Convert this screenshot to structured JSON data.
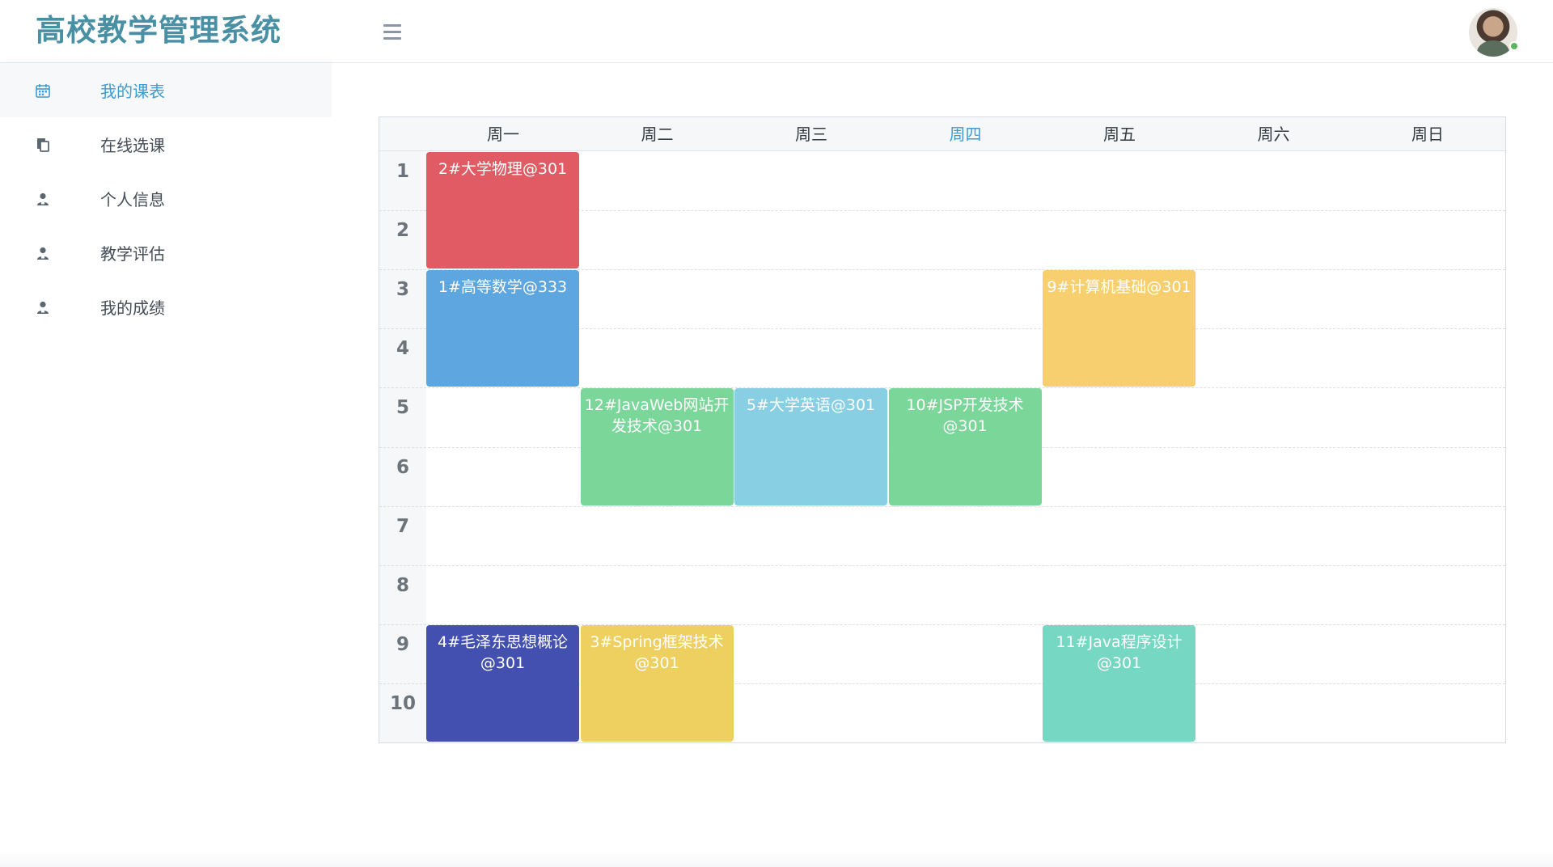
{
  "header": {
    "brand": "高校教学管理系统",
    "menu_icon": "hamburger-menu-icon",
    "avatar_status_color": "#5cb85c"
  },
  "sidebar": {
    "items": [
      {
        "label": "我的课表",
        "icon": "calendar-icon",
        "active": true
      },
      {
        "label": "在线选课",
        "icon": "copy-icon",
        "active": false
      },
      {
        "label": "个人信息",
        "icon": "user-icon",
        "active": false
      },
      {
        "label": "教学评估",
        "icon": "user-icon",
        "active": false
      },
      {
        "label": "我的成绩",
        "icon": "user-icon",
        "active": false
      }
    ]
  },
  "timetable": {
    "days": [
      "周一",
      "周二",
      "周三",
      "周四",
      "周五",
      "周六",
      "周日"
    ],
    "today_index": 3,
    "periods": [
      "1",
      "2",
      "3",
      "4",
      "5",
      "6",
      "7",
      "8",
      "9",
      "10"
    ],
    "courses": [
      {
        "text": "2#大学物理@301",
        "day": 0,
        "start": 1,
        "end": 2,
        "color": "#e05b64"
      },
      {
        "text": "1#高等数学@333",
        "day": 0,
        "start": 3,
        "end": 4,
        "color": "#5ea6e0"
      },
      {
        "text": "9#计算机基础@301",
        "day": 4,
        "start": 3,
        "end": 4,
        "color": "#f7cf6e"
      },
      {
        "text": "12#JavaWeb网站开发技术@301",
        "day": 1,
        "start": 5,
        "end": 6,
        "color": "#7bd69a"
      },
      {
        "text": "5#大学英语@301",
        "day": 2,
        "start": 5,
        "end": 6,
        "color": "#89cfe3"
      },
      {
        "text": "10#JSP开发技术@301",
        "day": 3,
        "start": 5,
        "end": 6,
        "color": "#7bd69a"
      },
      {
        "text": "4#毛泽东思想概论@301",
        "day": 0,
        "start": 9,
        "end": 10,
        "color": "#4350b0"
      },
      {
        "text": "3#Spring框架技术@301",
        "day": 1,
        "start": 9,
        "end": 10,
        "color": "#eed060"
      },
      {
        "text": "11#Java程序设计@301",
        "day": 4,
        "start": 9,
        "end": 10,
        "color": "#76d7c3"
      }
    ]
  }
}
